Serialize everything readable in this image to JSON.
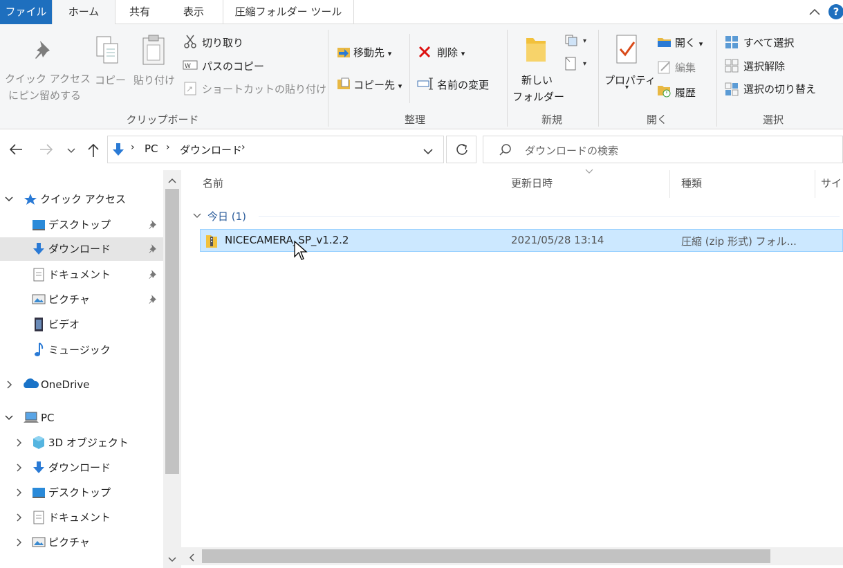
{
  "tabs": {
    "file": "ファイル",
    "home": "ホーム",
    "share": "共有",
    "view": "表示",
    "compressed_tools": "圧縮フォルダー ツール"
  },
  "ribbon": {
    "clipboard": {
      "pin_line1": "クイック アクセス",
      "pin_line2": "にピン留めする",
      "copy": "コピー",
      "paste": "貼り付け",
      "cut": "切り取り",
      "copy_path": "パスのコピー",
      "paste_shortcut": "ショートカットの貼り付け",
      "label": "クリップボード"
    },
    "organize": {
      "move_to": "移動先",
      "copy_to": "コピー先",
      "delete": "削除",
      "rename": "名前の変更",
      "label": "整理"
    },
    "new": {
      "new_folder_line1": "新しい",
      "new_folder_line2": "フォルダー",
      "label": "新規"
    },
    "open": {
      "properties": "プロパティ",
      "open": "開く",
      "edit": "編集",
      "history": "履歴",
      "label": "開く"
    },
    "select": {
      "select_all": "すべて選択",
      "select_none": "選択解除",
      "invert": "選択の切り替え",
      "label": "選択"
    }
  },
  "address": {
    "crumbs": [
      "PC",
      "ダウンロード"
    ],
    "search_placeholder": "ダウンロードの検索"
  },
  "nav": {
    "quick_access": "クイック アクセス",
    "desktop": "デスクトップ",
    "downloads": "ダウンロード",
    "documents": "ドキュメント",
    "pictures": "ピクチャ",
    "videos": "ビデオ",
    "music": "ミュージック",
    "onedrive": "OneDrive",
    "pc": "PC",
    "objects3d": "3D オブジェクト",
    "pc_downloads": "ダウンロード",
    "pc_desktop": "デスクトップ",
    "pc_documents": "ドキュメント",
    "pc_pictures": "ピクチャ"
  },
  "content": {
    "col_name": "名前",
    "col_date": "更新日時",
    "col_type": "種類",
    "col_size": "サイ",
    "group_today": "今日 (1)",
    "files": [
      {
        "name": "NICECAMERA_SP_v1.2.2",
        "date": "2021/05/28 13:14",
        "type": "圧縮 (zip 形式) フォル..."
      }
    ]
  },
  "colors": {
    "accent": "#1e6fbe",
    "selection": "#cce8ff",
    "selection_border": "#99d1ff"
  }
}
